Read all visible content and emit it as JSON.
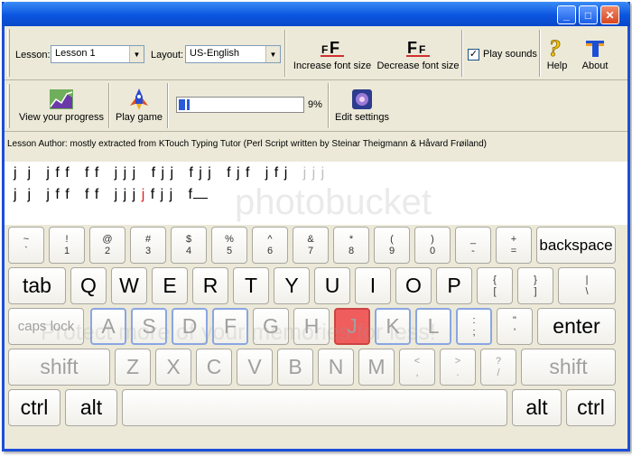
{
  "window": {
    "title": ""
  },
  "titlebar_buttons": [
    "_",
    "□",
    "✕"
  ],
  "toolbar1": {
    "lesson_label": "Lesson:",
    "lesson_value": "Lesson 1",
    "layout_label": "Layout:",
    "layout_value": "US-English",
    "increase_font": "Increase font size",
    "decrease_font": "Decrease font size",
    "play_sounds": "Play sounds",
    "play_sounds_checked": true,
    "help": "Help",
    "about": "About"
  },
  "toolbar2": {
    "view_progress": "View your progress",
    "play_game": "Play game",
    "progress_percent": 9,
    "progress_text": "9%",
    "edit_settings": "Edit settings"
  },
  "author": "Lesson Author: mostly extracted from KTouch Typing Tutor (Perl Script written by Steinar Theigmann & Håvard Frøiland)",
  "lesson_text": {
    "line1_done": "j  j   j f f   f f   j j j   f j j   f j j   f j f   j f j",
    "line1_todo": "   j j j",
    "line2_done": "j  j   j f f   f f   j j j ",
    "line2_err": "j",
    "line2_after": " f j j   f"
  },
  "keyboard": {
    "row1": [
      {
        "top": "~",
        "bottom": "`"
      },
      {
        "top": "!",
        "bottom": "1"
      },
      {
        "top": "@",
        "bottom": "2"
      },
      {
        "top": "#",
        "bottom": "3"
      },
      {
        "top": "$",
        "bottom": "4"
      },
      {
        "top": "%",
        "bottom": "5"
      },
      {
        "top": "^",
        "bottom": "6"
      },
      {
        "top": "&",
        "bottom": "7"
      },
      {
        "top": "*",
        "bottom": "8"
      },
      {
        "top": "(",
        "bottom": "9"
      },
      {
        "top": ")",
        "bottom": "0"
      },
      {
        "top": "_",
        "bottom": "-"
      },
      {
        "top": "+",
        "bottom": "="
      }
    ],
    "backspace": "backspace",
    "tab": "tab",
    "row2": [
      "Q",
      "W",
      "E",
      "R",
      "T",
      "Y",
      "U",
      "I",
      "O",
      "P"
    ],
    "row2_sym": [
      {
        "top": "{",
        "bottom": "["
      },
      {
        "top": "}",
        "bottom": "]"
      },
      {
        "top": "|",
        "bottom": "\\"
      }
    ],
    "caps": "caps lock",
    "row3": [
      "A",
      "S",
      "D",
      "F",
      "G",
      "H",
      "J",
      "K",
      "L"
    ],
    "row3_sym": [
      {
        "top": ":",
        "bottom": ";"
      },
      {
        "top": "\"",
        "bottom": "'"
      }
    ],
    "enter": "enter",
    "shift": "shift",
    "row4": [
      "Z",
      "X",
      "C",
      "V",
      "B",
      "N",
      "M"
    ],
    "row4_sym": [
      {
        "top": "<",
        "bottom": ","
      },
      {
        "top": ">",
        "bottom": "."
      },
      {
        "top": "?",
        "bottom": "/"
      }
    ],
    "ctrl": "ctrl",
    "alt": "alt"
  },
  "watermark": {
    "logo": "photobucket",
    "tagline": "Protect more of your memories for less!"
  }
}
